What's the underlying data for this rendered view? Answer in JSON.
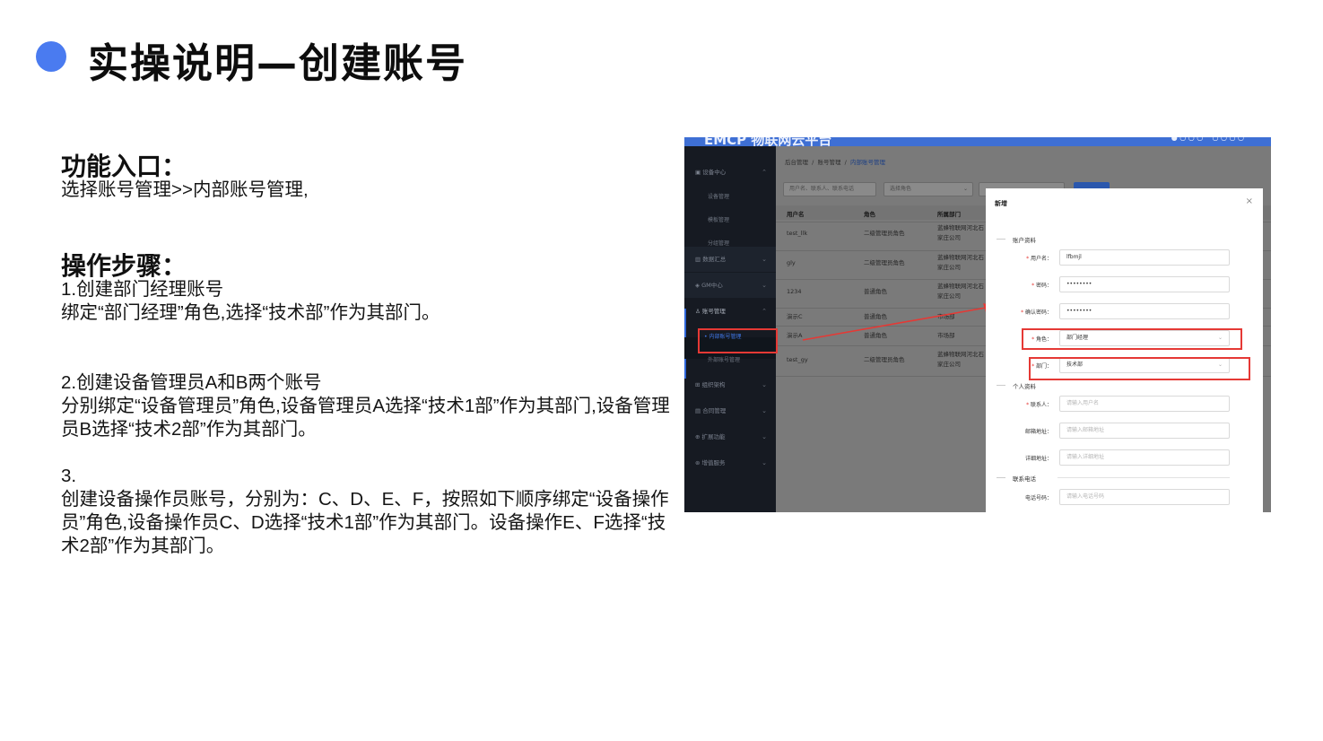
{
  "slide": {
    "title": "实操说明—创建账号",
    "accent_color": "#4a7bf0"
  },
  "content": {
    "entry_heading": "功能入口：",
    "entry_text": "选择账号管理>>内部账号管理,",
    "steps_heading": "操作步骤：",
    "step1_title": "1.创建部门经理账号",
    "step1_text": "绑定“部门经理”角色,选择“技术部”作为其部门。",
    "step2_title": "2.创建设备管理员A和B两个账号",
    "step2_text": "分别绑定“设备管理员”角色,设备管理员A选择“技术1部”作为其部门,设备管理员B选择“技术2部”作为其部门。",
    "step3_title": "3.",
    "step3_text": "创建设备操作员账号，分别为：C、D、E、F，按照如下顺序绑定“设备操作员”角色,设备操作员C、D选择“技术1部”作为其部门。设备操作E、F选择“技术2部”作为其部门。"
  },
  "screenshot": {
    "brand": "EMCP 物联网云平台",
    "sidebar": {
      "device_center": "设备中心",
      "device_manage": "设备管理",
      "template_manage": "模板管理",
      "group_manage": "分组管理",
      "data_summary": "数据汇总",
      "gm_center": "GM中心",
      "account_manage": "账号管理",
      "internal_account": "• 内部账号管理",
      "external_account": "外部账号管理",
      "org_structure": "组织架构",
      "contract_manage": "合同管理",
      "extend_func": "扩展功能",
      "value_service": "增值服务"
    },
    "breadcrumb": {
      "home": "后台管理",
      "sep": "/",
      "account": "账号管理",
      "current": "内部账号管理"
    },
    "filters": {
      "search_placeholder": "用户名、联系人、联系电话",
      "role_placeholder": "选择角色"
    },
    "table": {
      "headers": [
        "用户名",
        "角色",
        "所属部门"
      ],
      "rows": [
        [
          "test_llk",
          "二级管理员角色",
          "蓝蜂物联网河北石家庄公司"
        ],
        [
          "gly",
          "二级管理员角色",
          "蓝蜂物联网河北石家庄公司"
        ],
        [
          "1234",
          "普通角色",
          "蓝蜂物联网河北石家庄公司"
        ],
        [
          "演示C",
          "普通角色",
          "市场部"
        ],
        [
          "演示A",
          "普通角色",
          "市场部"
        ],
        [
          "test_gy",
          "二级管理员角色",
          "蓝蜂物联网河北石家庄公司"
        ]
      ]
    },
    "dialog": {
      "title": "新增",
      "close": "×",
      "section_account": "账户资料",
      "username_label": "用户名：",
      "username_value": "lfbmjl",
      "password_label": "密码：",
      "password_value": "••••••••",
      "confirm_label": "确认密码：",
      "confirm_value": "••••••••",
      "role_label": "角色：",
      "role_value": "部门经理",
      "dept_label": "部门：",
      "dept_value": "技术部",
      "section_personal": "个人资料",
      "contact_label": "联系人：",
      "contact_placeholder": "请输入用户名",
      "email_label": "邮箱地址：",
      "email_placeholder": "请输入邮箱地址",
      "address_label": "详细地址：",
      "address_placeholder": "请输入详细地址",
      "section_phone": "联系电话",
      "phone_label": "电话号码：",
      "phone_placeholder": "请输入电话号码"
    },
    "highlight_color": "#e53935"
  }
}
